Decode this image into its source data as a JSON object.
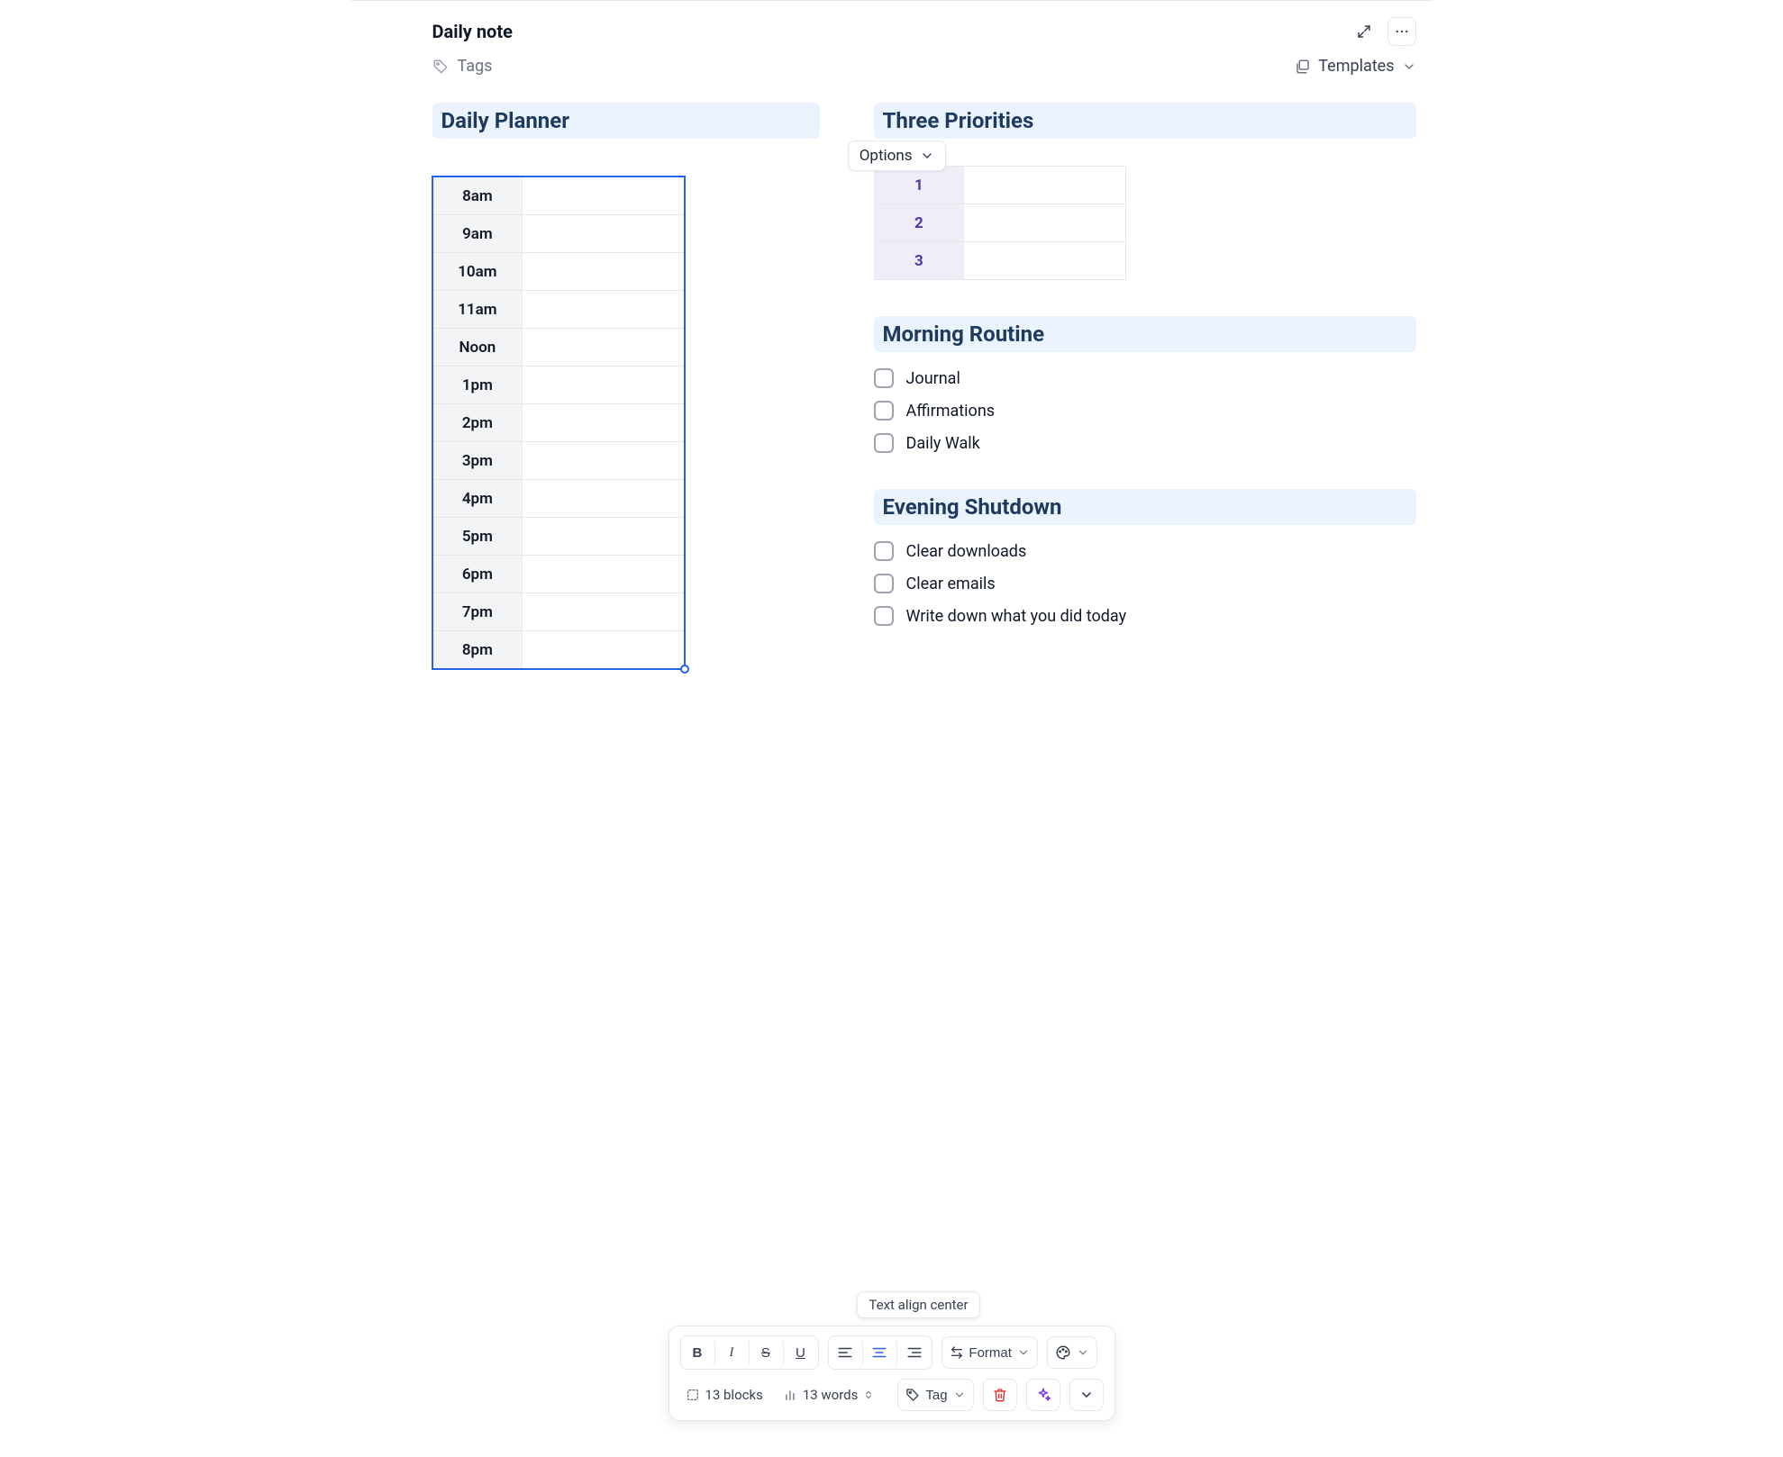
{
  "header": {
    "title": "Daily note",
    "tags_label": "Tags",
    "templates_label": "Templates"
  },
  "left": {
    "heading": "Daily Planner",
    "options_label": "Options",
    "times": [
      "8am",
      "9am",
      "10am",
      "11am",
      "Noon",
      "1pm",
      "2pm",
      "3pm",
      "4pm",
      "5pm",
      "6pm",
      "7pm",
      "8pm"
    ]
  },
  "right": {
    "priorities_heading": "Three Priorities",
    "priorities": [
      "1",
      "2",
      "3"
    ],
    "morning_heading": "Morning Routine",
    "morning_items": [
      "Journal",
      "Affirmations",
      "Daily Walk"
    ],
    "evening_heading": "Evening Shutdown",
    "evening_items": [
      "Clear downloads",
      "Clear emails",
      "Write down what you did today"
    ]
  },
  "toolbar": {
    "tooltip": "Text align center",
    "format_label": "Format",
    "tag_label": "Tag",
    "blocks_label": "13 blocks",
    "words_label": "13 words"
  }
}
